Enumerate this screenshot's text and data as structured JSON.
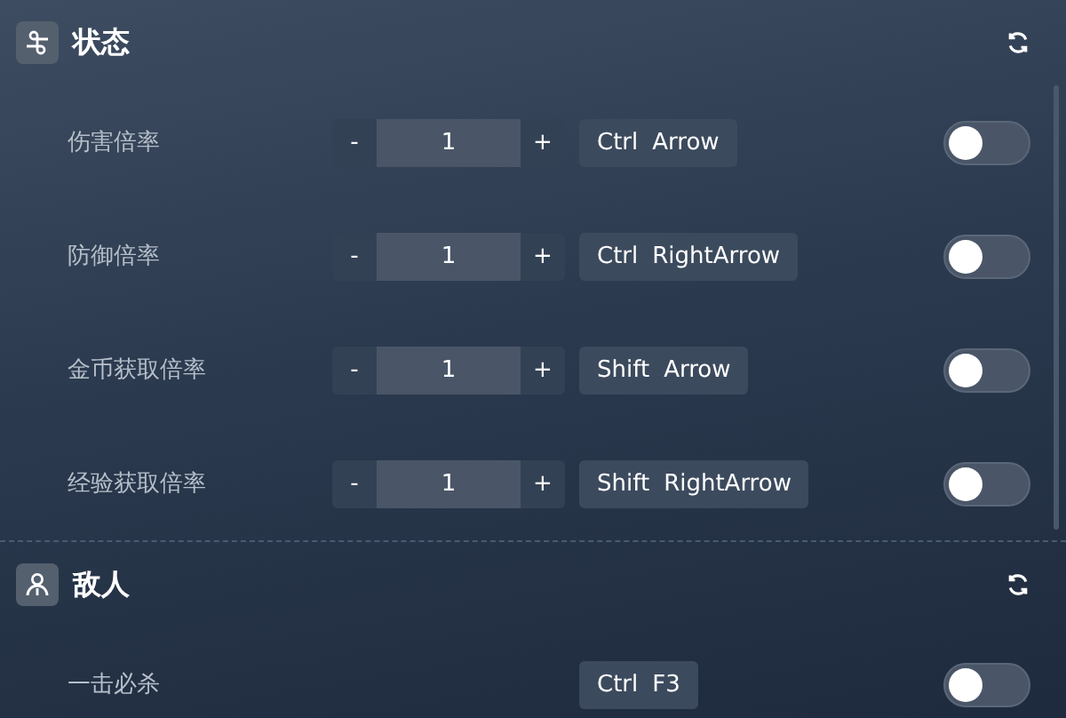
{
  "sections": [
    {
      "title": "状态",
      "rows": [
        {
          "kind": "stepper",
          "label": "伤害倍率",
          "minus": "-",
          "value": "1",
          "plus": "+",
          "keys": [
            "Ctrl",
            "Arrow"
          ],
          "on": false
        },
        {
          "kind": "stepper",
          "label": "防御倍率",
          "minus": "-",
          "value": "1",
          "plus": "+",
          "keys": [
            "Ctrl",
            "RightArrow"
          ],
          "on": false
        },
        {
          "kind": "stepper",
          "label": "金币获取倍率",
          "minus": "-",
          "value": "1",
          "plus": "+",
          "keys": [
            "Shift",
            "Arrow"
          ],
          "on": false
        },
        {
          "kind": "stepper",
          "label": "经验获取倍率",
          "minus": "-",
          "value": "1",
          "plus": "+",
          "keys": [
            "Shift",
            "RightArrow"
          ],
          "on": false
        }
      ]
    },
    {
      "title": "敌人",
      "rows": [
        {
          "kind": "toggle",
          "label": "一击必杀",
          "keys": [
            "Ctrl",
            "F3"
          ],
          "on": false
        }
      ]
    }
  ]
}
